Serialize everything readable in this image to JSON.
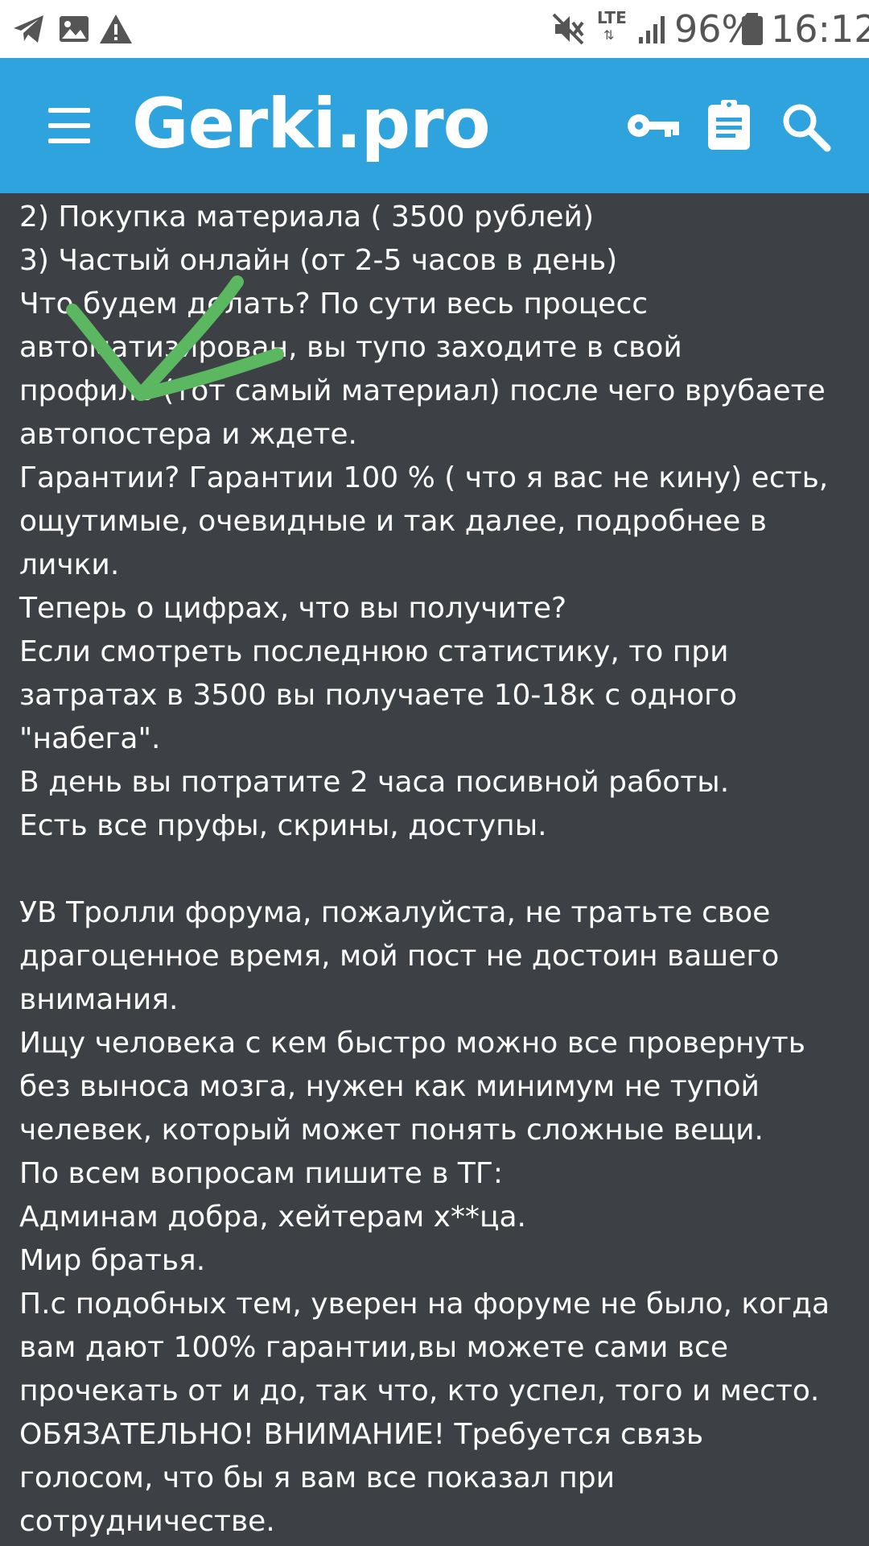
{
  "status_bar": {
    "icons": [
      "telegram-icon",
      "image-icon",
      "warning-icon",
      "mute-icon",
      "signal-icon",
      "battery-icon"
    ],
    "network": "LTE",
    "battery": "96%",
    "time": "16:12"
  },
  "app_bar": {
    "title": "Gerki.pro",
    "icons": [
      "menu-icon",
      "key-icon",
      "clipboard-icon",
      "search-icon"
    ],
    "background_color": "#2ea3de"
  },
  "post": {
    "background_color": "#3d4045",
    "annotation_color": "#5cb860",
    "lines": [
      "2) Покупка материала ( 3500 рублей)",
      "3) Частый онлайн (от 2-5 часов в день)",
      "Что будем делать? По сути весь процесс",
      "автоматизирован, вы тупо заходите в свой",
      "профиль (тот самый материал) после чего врубаете",
      "автопостера и ждете.",
      "Гарантии? Гарантии 100 % ( что я вас не кину) есть,",
      "ощутимые, очевидные и так далее, подробнее в",
      "лички.",
      "Теперь о цифрах, что вы получите?",
      "Если смотреть последнюю статистику, то при",
      "затратах в 3500 вы получаете 10-18к с одного",
      "\"набега\".",
      "В день вы потратите 2 часа посивной работы.",
      "Есть все пруфы, скрины, доступы.",
      "",
      "УВ Тролли форума, пожалуйста, не тратьте свое",
      "драгоценное время, мой пост не достоин вашего",
      "внимания.",
      "Ищу человека с кем быстро можно все провернуть",
      "без выноса мозга, нужен как минимум не тупой",
      "челевек, который может понять сложные вещи.",
      "По всем вопросам пишите в ТГ:",
      "Админам добра, хейтерам х**ца.",
      "Мир братья.",
      "П.с подобных тем, уверен на форуме не было, когда",
      "вам дают 100% гарантии,вы можете сами все",
      "прочекать от и до, так что, кто успел, того и место.",
      "ОБЯЗАТЕЛЬНО! ВНИМАНИЕ! Требуется связь",
      "голосом, что бы я вам все показал при",
      "сотрудничестве."
    ]
  }
}
